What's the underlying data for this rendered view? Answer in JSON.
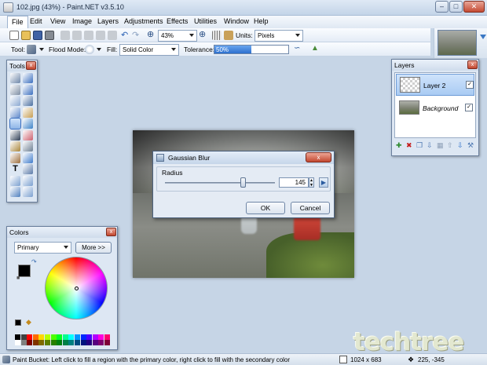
{
  "window": {
    "title": "102.jpg (43%) - Paint.NET v3.5.10",
    "minimize": "–",
    "maximize": "□",
    "close": "✕"
  },
  "menu": [
    "File",
    "Edit",
    "View",
    "Image",
    "Layers",
    "Adjustments",
    "Effects",
    "Utilities",
    "Window",
    "Help"
  ],
  "toolbar": {
    "zoom_value": "43%",
    "units_label": "Units:",
    "units_value": "Pixels",
    "tool_label": "Tool:",
    "flood_mode_label": "Flood Mode:",
    "fill_label": "Fill:",
    "fill_value": "Solid Color",
    "tolerance_label": "Tolerance:",
    "tolerance_value": "50%",
    "tolerance_fraction": 0.5
  },
  "tools_panel": {
    "title": "Tools",
    "close": "x"
  },
  "layers_panel": {
    "title": "Layers",
    "close": "x",
    "layers": [
      {
        "name": "Layer 2",
        "checked": "✓",
        "selected": true
      },
      {
        "name": "Background",
        "checked": "✓",
        "selected": false
      }
    ]
  },
  "colors_panel": {
    "title": "Colors",
    "close": "x",
    "palette_select": "Primary",
    "more_button": "More >>"
  },
  "dialog": {
    "title": "Gaussian Blur",
    "close": "x",
    "radius_label": "Radius",
    "radius_value": "145",
    "radius_fraction": 0.72,
    "ok": "OK",
    "cancel": "Cancel"
  },
  "status": {
    "text": "Paint Bucket: Left click to fill a region with the primary color, right click to fill with the secondary color",
    "size": "1024 x 683",
    "coords": "225, -345"
  },
  "watermark": "techtree",
  "palette_colors": [
    "#000000",
    "#404040",
    "#ff0000",
    "#ff6a00",
    "#ffd800",
    "#b6ff00",
    "#4cff00",
    "#00ff21",
    "#00ff90",
    "#00ffff",
    "#0094ff",
    "#0026ff",
    "#4800ff",
    "#b200ff",
    "#ff00dc",
    "#ff006e",
    "#ffffff",
    "#808080",
    "#7f0000",
    "#7f3300",
    "#7f6a00",
    "#5b7f00",
    "#267f00",
    "#007f0e",
    "#007f46",
    "#007f7f",
    "#004a7f",
    "#00137f",
    "#21007f",
    "#57007f",
    "#7f006e",
    "#7f0037"
  ]
}
